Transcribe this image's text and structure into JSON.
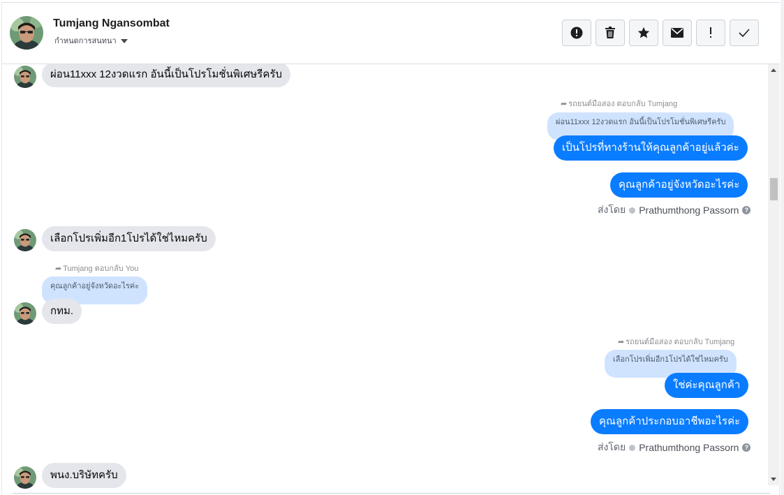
{
  "header": {
    "name": "Tumjang Ngansombat",
    "subtitle": "กำหนดการสนทนา"
  },
  "toolbar": {
    "buttons": [
      {
        "icon": "alert-circle-icon",
        "label": "report"
      },
      {
        "icon": "trash-icon",
        "label": "delete"
      },
      {
        "icon": "star-icon",
        "label": "star"
      },
      {
        "icon": "envelope-icon",
        "label": "mark-unread"
      },
      {
        "icon": "exclamation-icon",
        "label": "important"
      },
      {
        "icon": "check-icon",
        "label": "done"
      }
    ]
  },
  "messages": {
    "m1": "ผ่อน11xxx 12งวดแรก อันนี้เป็นโปรโมชั่นพิเศษรีครับ",
    "reply1_note": "รถยนต์มือสอง ตอบกลับ Tumjang",
    "reply1_quote": "ผ่อน11xxx 12งวดแรก อันนี้เป็นโปรโมชั่นพิเศษรีครับ",
    "reply1_text": "เป็นโปรที่ทางร้านให้คุณลูกค้าอยู่แล้วค่ะ",
    "out2": "คุณลูกค้าอยู่จังหวัดอะไรค่ะ",
    "sent1_prefix": "ส่งโดย",
    "sent1_name": "Prathumthong Passorn",
    "m2": "เลือกโปรเพิ่มอีก1โปรได้ใช่ไหมครับ",
    "reply2_note": "Tumjang ตอบกลับ You",
    "reply2_quote": "คุณลูกค้าอยู่จังหวัดอะไรค่ะ",
    "reply2_text": "กทม.",
    "reply3_note": "รถยนต์มือสอง ตอบกลับ Tumjang",
    "reply3_quote": "เลือกโปรเพิ่มอีก1โปรได้ใช่ไหมครับ",
    "reply3_text": "ใช่ค่ะคุณลูกค้า",
    "out4": "คุณลูกค้าประกอบอาชีพอะไรค่ะ",
    "sent2_prefix": "ส่งโดย",
    "sent2_name": "Prathumthong Passorn",
    "m3": "พนง.บริษัทครับ"
  },
  "colors": {
    "outgoing": "#0a7cff",
    "incoming": "#e4e6eb",
    "quote": "#cfe3ff"
  }
}
